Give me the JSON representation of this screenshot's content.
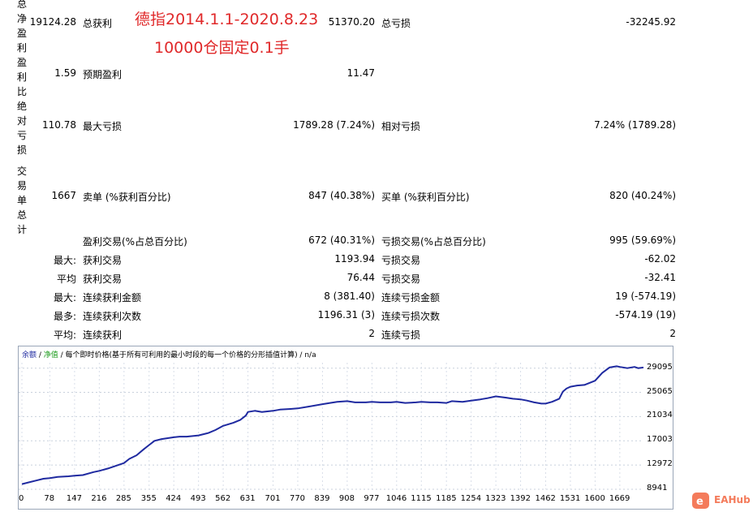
{
  "side_labels": [
    "总净盈利",
    "盈利比",
    "绝对亏损",
    "交易单总计"
  ],
  "title_red": {
    "line1": "德指2014.1.1-2020.8.23",
    "line2": "10000仓固定0.1手"
  },
  "row1": {
    "val": "19124.28",
    "l1": "总获利",
    "v1": "51370.20",
    "l2": "总亏损",
    "v2": "-32245.92"
  },
  "row2": {
    "val": "1.59",
    "l1": "预期盈利",
    "v1": "11.47"
  },
  "row3": {
    "val": "110.78",
    "l1": "最大亏损",
    "v1": "1789.28 (7.24%)",
    "l2": "相对亏损",
    "v2": "7.24% (1789.28)"
  },
  "row4": {
    "val": "1667",
    "l1": "卖单 (%获利百分比)",
    "v1": "847 (40.38%)",
    "l2": "买单 (%获利百分比)",
    "v2": "820 (40.24%)"
  },
  "rows_bottom": [
    {
      "p": "",
      "l1": "盈利交易(%占总百分比)",
      "v1": "672 (40.31%)",
      "l2": "亏损交易(%占总百分比)",
      "v2": "995 (59.69%)"
    },
    {
      "p": "最大:",
      "l1": "获利交易",
      "v1": "1193.94",
      "l2": "亏损交易",
      "v2": "-62.02"
    },
    {
      "p": "平均",
      "l1": "获利交易",
      "v1": "76.44",
      "l2": "亏损交易",
      "v2": "-32.41"
    },
    {
      "p": "最大:",
      "l1": "连续获利金额",
      "v1": "8 (381.40)",
      "l2": "连续亏损金额",
      "v2": "19 (-574.19)"
    },
    {
      "p": "最多:",
      "l1": "连续获利次数",
      "v1": "1196.31 (3)",
      "l2": "连续亏损次数",
      "v2": "-574.19 (19)"
    },
    {
      "p": "平均:",
      "l1": "连续获利",
      "v1": "2",
      "l2": "连续亏损",
      "v2": "2"
    }
  ],
  "legend": {
    "balance": "余额",
    "sep1": " / ",
    "equity": "净值",
    "rest": " / 每个即时价格(基于所有可利用的最小时段的每一个价格的分形插值计算) / n/a"
  },
  "chart_data": {
    "type": "line",
    "x_ticks": [
      "0",
      "78",
      "147",
      "216",
      "285",
      "355",
      "424",
      "493",
      "562",
      "631",
      "701",
      "770",
      "839",
      "908",
      "977",
      "1046",
      "1115",
      "1185",
      "1254",
      "1323",
      "1392",
      "1462",
      "1531",
      "1600",
      "1669"
    ],
    "y_ticks": [
      "29095",
      "25065",
      "21034",
      "17003",
      "12972",
      "8941"
    ],
    "ylim": [
      8941,
      30000
    ],
    "xlim": [
      0,
      1735
    ],
    "series": [
      {
        "color": "#1f2aa0",
        "x": [
          0,
          20,
          40,
          60,
          78,
          100,
          130,
          147,
          170,
          200,
          216,
          240,
          260,
          285,
          300,
          320,
          340,
          355,
          370,
          390,
          424,
          440,
          460,
          493,
          520,
          540,
          562,
          590,
          610,
          625,
          631,
          650,
          670,
          701,
          720,
          750,
          770,
          800,
          839,
          860,
          880,
          908,
          930,
          960,
          977,
          1000,
          1030,
          1046,
          1070,
          1100,
          1115,
          1140,
          1160,
          1185,
          1200,
          1230,
          1254,
          1280,
          1300,
          1323,
          1350,
          1370,
          1392,
          1410,
          1430,
          1450,
          1462,
          1480,
          1500,
          1510,
          1520,
          1531,
          1550,
          1570,
          1600,
          1620,
          1640,
          1660,
          1669,
          1690,
          1710,
          1720,
          1735
        ],
        "y": [
          9800,
          10100,
          10400,
          10700,
          10800,
          11000,
          11100,
          11200,
          11300,
          11800,
          12000,
          12400,
          12800,
          13300,
          14000,
          14600,
          15600,
          16300,
          17000,
          17300,
          17600,
          17700,
          17700,
          17900,
          18300,
          18800,
          19500,
          20000,
          20500,
          21200,
          21800,
          22000,
          21800,
          22000,
          22200,
          22300,
          22400,
          22700,
          23100,
          23300,
          23500,
          23600,
          23400,
          23400,
          23500,
          23400,
          23400,
          23500,
          23300,
          23400,
          23500,
          23400,
          23400,
          23300,
          23600,
          23500,
          23700,
          23900,
          24100,
          24400,
          24200,
          24000,
          23900,
          23700,
          23400,
          23200,
          23200,
          23500,
          24000,
          25200,
          25700,
          26000,
          26200,
          26300,
          27000,
          28300,
          29200,
          29400,
          29300,
          29100,
          29300,
          29100,
          29200
        ]
      }
    ]
  },
  "brand": {
    "text": "EAHub",
    "color": "#f47b5b"
  }
}
